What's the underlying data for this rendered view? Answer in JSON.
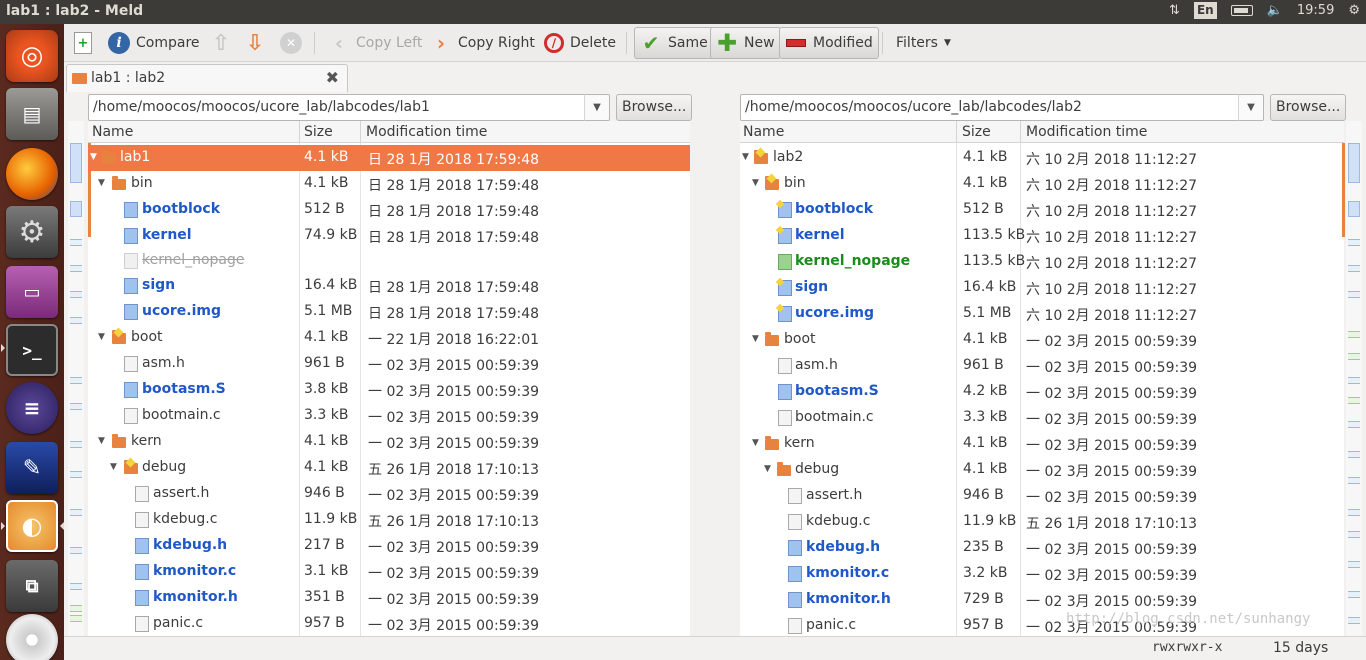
{
  "topbar": {
    "title": "lab1 : lab2 - Meld",
    "keyboard": "En",
    "time": "19:59"
  },
  "launcher": {
    "apps": [
      "ubuntu-icon",
      "files-icon",
      "firefox-icon",
      "settings-icon",
      "workspace-icon",
      "terminal-icon",
      "eclipse-icon",
      "scribble-icon",
      "meld-icon",
      "windows-icon",
      "disc-icon"
    ]
  },
  "toolbar": {
    "compare": "Compare",
    "copy_left": "Copy Left",
    "copy_right": "Copy Right",
    "delete": "Delete",
    "same": "Same",
    "new": "New",
    "modified": "Modified",
    "filters": "Filters"
  },
  "tab": {
    "label": "lab1 : lab2"
  },
  "left": {
    "path": "/home/moocos/moocos/ucore_lab/labcodes/lab1",
    "browse": "Browse...",
    "headers": {
      "name": "Name",
      "size": "Size",
      "mtime": "Modification time"
    },
    "rows": [
      {
        "name": "lab1",
        "size": "4.1 kB",
        "mtime": "日 28  1月 2018 17:59:48"
      },
      {
        "name": "bin",
        "size": "4.1 kB",
        "mtime": "日 28  1月 2018 17:59:48"
      },
      {
        "name": "bootblock",
        "size": "512 B",
        "mtime": "日 28  1月 2018 17:59:48"
      },
      {
        "name": "kernel",
        "size": "74.9 kB",
        "mtime": "日 28  1月 2018 17:59:48"
      },
      {
        "name": "kernel_nopage",
        "size": "",
        "mtime": ""
      },
      {
        "name": "sign",
        "size": "16.4 kB",
        "mtime": "日 28  1月 2018 17:59:48"
      },
      {
        "name": "ucore.img",
        "size": "5.1 MB",
        "mtime": "日 28  1月 2018 17:59:48"
      },
      {
        "name": "boot",
        "size": "4.1 kB",
        "mtime": "一 22  1月 2018 16:22:01"
      },
      {
        "name": "asm.h",
        "size": "961 B",
        "mtime": "一 02  3月 2015 00:59:39"
      },
      {
        "name": "bootasm.S",
        "size": "3.8 kB",
        "mtime": "一 02  3月 2015 00:59:39"
      },
      {
        "name": "bootmain.c",
        "size": "3.3 kB",
        "mtime": "一 02  3月 2015 00:59:39"
      },
      {
        "name": "kern",
        "size": "4.1 kB",
        "mtime": "一 02  3月 2015 00:59:39"
      },
      {
        "name": "debug",
        "size": "4.1 kB",
        "mtime": "五 26  1月 2018 17:10:13"
      },
      {
        "name": "assert.h",
        "size": "946 B",
        "mtime": "一 02  3月 2015 00:59:39"
      },
      {
        "name": "kdebug.c",
        "size": "11.9 kB",
        "mtime": "五 26  1月 2018 17:10:13"
      },
      {
        "name": "kdebug.h",
        "size": "217 B",
        "mtime": "一 02  3月 2015 00:59:39"
      },
      {
        "name": "kmonitor.c",
        "size": "3.1 kB",
        "mtime": "一 02  3月 2015 00:59:39"
      },
      {
        "name": "kmonitor.h",
        "size": "351 B",
        "mtime": "一 02  3月 2015 00:59:39"
      },
      {
        "name": "panic.c",
        "size": "957 B",
        "mtime": "一 02  3月 2015 00:59:39"
      }
    ]
  },
  "right": {
    "path": "/home/moocos/moocos/ucore_lab/labcodes/lab2",
    "browse": "Browse...",
    "headers": {
      "name": "Name",
      "size": "Size",
      "mtime": "Modification time"
    },
    "rows": [
      {
        "name": "lab2",
        "size": "4.1 kB",
        "mtime": "六 10  2月 2018 11:12:27"
      },
      {
        "name": "bin",
        "size": "4.1 kB",
        "mtime": "六 10  2月 2018 11:12:27"
      },
      {
        "name": "bootblock",
        "size": "512 B",
        "mtime": "六 10  2月 2018 11:12:27"
      },
      {
        "name": "kernel",
        "size": "113.5 kB",
        "mtime": "六 10  2月 2018 11:12:27"
      },
      {
        "name": "kernel_nopage",
        "size": "113.5 kB",
        "mtime": "六 10  2月 2018 11:12:27"
      },
      {
        "name": "sign",
        "size": "16.4 kB",
        "mtime": "六 10  2月 2018 11:12:27"
      },
      {
        "name": "ucore.img",
        "size": "5.1 MB",
        "mtime": "六 10  2月 2018 11:12:27"
      },
      {
        "name": "boot",
        "size": "4.1 kB",
        "mtime": "一 02  3月 2015 00:59:39"
      },
      {
        "name": "asm.h",
        "size": "961 B",
        "mtime": "一 02  3月 2015 00:59:39"
      },
      {
        "name": "bootasm.S",
        "size": "4.2 kB",
        "mtime": "一 02  3月 2015 00:59:39"
      },
      {
        "name": "bootmain.c",
        "size": "3.3 kB",
        "mtime": "一 02  3月 2015 00:59:39"
      },
      {
        "name": "kern",
        "size": "4.1 kB",
        "mtime": "一 02  3月 2015 00:59:39"
      },
      {
        "name": "debug",
        "size": "4.1 kB",
        "mtime": "一 02  3月 2015 00:59:39"
      },
      {
        "name": "assert.h",
        "size": "946 B",
        "mtime": "一 02  3月 2015 00:59:39"
      },
      {
        "name": "kdebug.c",
        "size": "11.9 kB",
        "mtime": "五 26  1月 2018 17:10:13"
      },
      {
        "name": "kdebug.h",
        "size": "235 B",
        "mtime": "一 02  3月 2015 00:59:39"
      },
      {
        "name": "kmonitor.c",
        "size": "3.2 kB",
        "mtime": "一 02  3月 2015 00:59:39"
      },
      {
        "name": "kmonitor.h",
        "size": "729 B",
        "mtime": "一 02  3月 2015 00:59:39"
      },
      {
        "name": "panic.c",
        "size": "957 B",
        "mtime": "一 02  3月 2015 00:59:39"
      }
    ]
  },
  "status": {
    "perms": "rwxrwxr-x",
    "age": "15 days"
  },
  "watermark": "http://blog.csdn.net/sunhangy",
  "colors": {
    "selection": "#f07746",
    "modified": "#1f58c8",
    "new": "#1a8c1a",
    "missing": "#a0a0a0",
    "launcher": "#5a2a1e"
  }
}
